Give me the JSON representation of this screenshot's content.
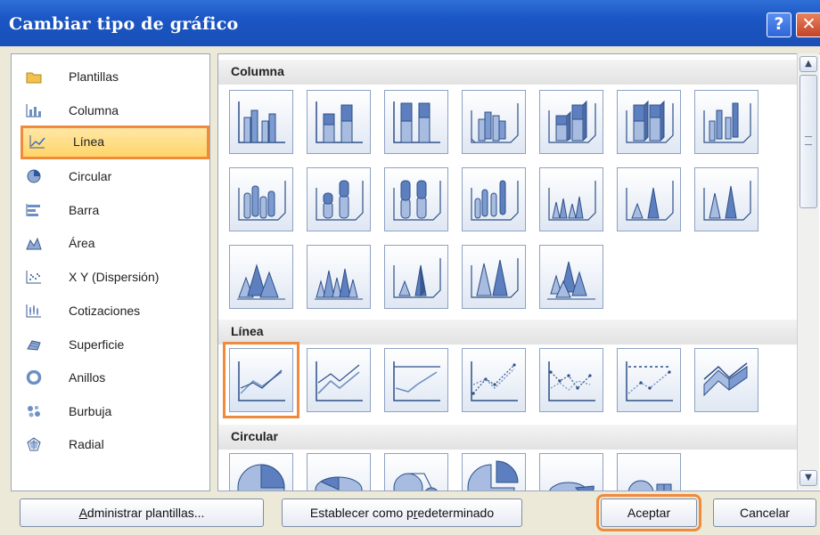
{
  "dialog": {
    "title": "Cambiar tipo de gráfico",
    "help_glyph": "?",
    "close_glyph": "✕"
  },
  "categories": [
    {
      "label": "Plantillas",
      "icon": "folder-icon"
    },
    {
      "label": "Columna",
      "icon": "column-chart-icon"
    },
    {
      "label": "Línea",
      "icon": "line-chart-icon",
      "selected": true
    },
    {
      "label": "Circular",
      "icon": "pie-chart-icon"
    },
    {
      "label": "Barra",
      "icon": "bar-chart-icon"
    },
    {
      "label": "Área",
      "icon": "area-chart-icon"
    },
    {
      "label": "X Y (Dispersión)",
      "icon": "scatter-chart-icon"
    },
    {
      "label": "Cotizaciones",
      "icon": "stock-chart-icon"
    },
    {
      "label": "Superficie",
      "icon": "surface-chart-icon"
    },
    {
      "label": "Anillos",
      "icon": "doughnut-chart-icon"
    },
    {
      "label": "Burbuja",
      "icon": "bubble-chart-icon"
    },
    {
      "label": "Radial",
      "icon": "radar-chart-icon"
    }
  ],
  "sections": {
    "columna": {
      "title": "Columna"
    },
    "linea": {
      "title": "Línea"
    },
    "circular": {
      "title": "Circular"
    }
  },
  "buttons": {
    "manage_templates": {
      "pre": "",
      "key": "A",
      "post": "dministrar plantillas..."
    },
    "set_default": {
      "pre": "Establecer como p",
      "key": "r",
      "post": "edeterminado"
    },
    "accept": "Aceptar",
    "cancel": "Cancelar"
  },
  "colors": {
    "highlight": "#f08a3c",
    "title_bar": "#1b56c4",
    "selected_fill": "#ffd56a"
  }
}
